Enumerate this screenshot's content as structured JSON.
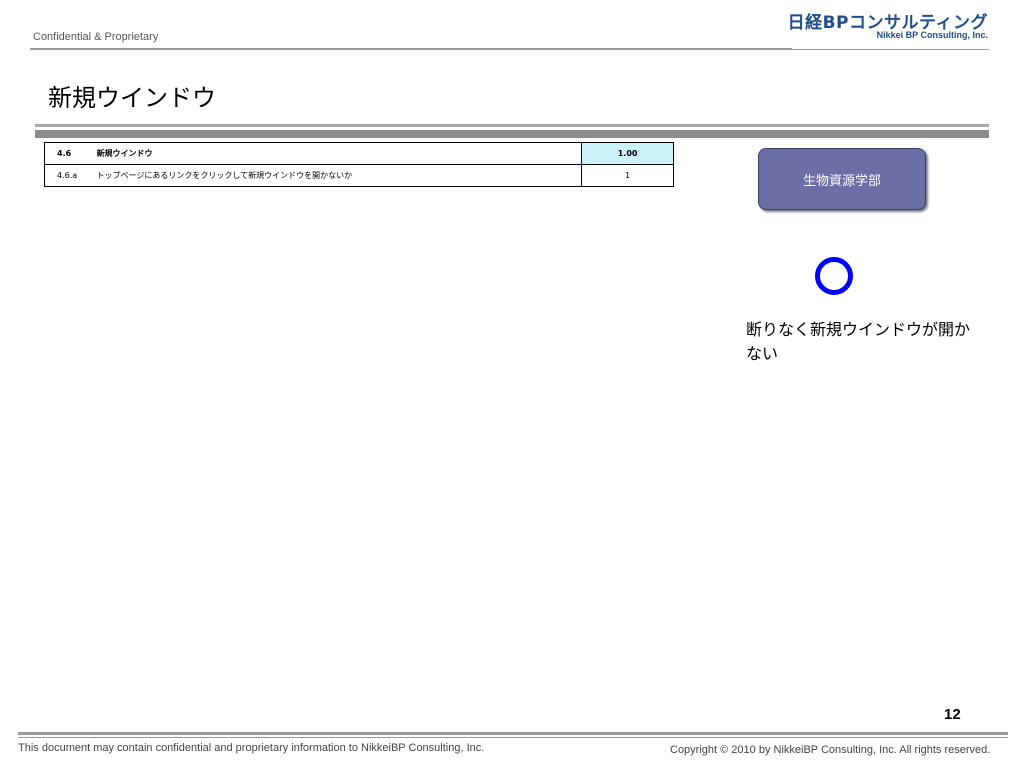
{
  "header": {
    "confidential": "Confidential & Proprietary",
    "logo_jp": "日経BPコンサルティング",
    "logo_en": "Nikkei BP Consulting, Inc."
  },
  "title": "新規ウインドウ",
  "table": {
    "rows": [
      {
        "id": "4.6",
        "desc": "新規ウインドウ",
        "value": "1.00"
      },
      {
        "id": "4.6.a",
        "desc": "トップページにあるリンクをクリックして新規ウインドウを開かないか",
        "value": "1"
      }
    ]
  },
  "category_button": "生物資源学部",
  "result_symbol": "circle",
  "result_text": "断りなく新規ウインドウが開かない",
  "page_number": "12",
  "footer": {
    "left": "This document may contain confidential and proprietary information to NikkeiBP Consulting, Inc.",
    "right": "Copyright © 2010 by NikkeiBP Consulting, Inc. All rights reserved."
  },
  "colors": {
    "header_value_cell": "#ccf3fb",
    "button_bg": "#6b6fa6",
    "circle": "#0000ff",
    "logo": "#1f4e8c"
  }
}
